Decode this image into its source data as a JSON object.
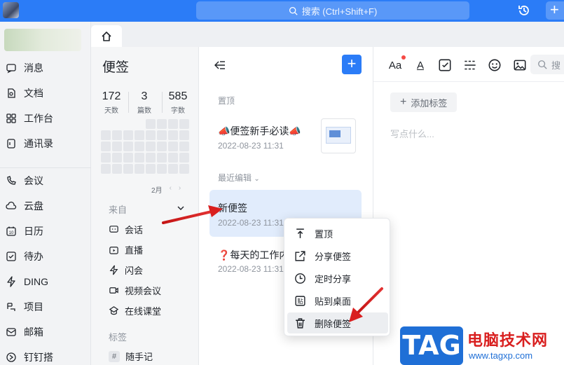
{
  "topbar": {
    "search_placeholder": "搜索 (Ctrl+Shift+F)",
    "brand_color": "#2b7cf7"
  },
  "sidebar": {
    "items": [
      {
        "label": "消息",
        "icon": "message-icon"
      },
      {
        "label": "文档",
        "icon": "document-icon"
      },
      {
        "label": "工作台",
        "icon": "workbench-icon"
      },
      {
        "label": "通讯录",
        "icon": "contacts-icon"
      },
      {
        "label": "会议",
        "icon": "meeting-icon"
      },
      {
        "label": "云盘",
        "icon": "cloud-icon"
      },
      {
        "label": "日历",
        "icon": "calendar-icon"
      },
      {
        "label": "待办",
        "icon": "todo-icon"
      },
      {
        "label": "DING",
        "icon": "ding-icon"
      },
      {
        "label": "项目",
        "icon": "project-icon"
      },
      {
        "label": "邮箱",
        "icon": "mail-icon"
      },
      {
        "label": "钉钉搭",
        "icon": "builder-icon"
      }
    ]
  },
  "category": {
    "title": "便签",
    "stats": [
      {
        "value": "172",
        "label": "天数"
      },
      {
        "value": "3",
        "label": "篇数"
      },
      {
        "value": "585",
        "label": "字数"
      }
    ],
    "month": "2月",
    "source_label": "来自",
    "sources": [
      {
        "label": "会话",
        "icon": "chat-icon"
      },
      {
        "label": "直播",
        "icon": "live-icon"
      },
      {
        "label": "闪会",
        "icon": "flash-meeting-icon"
      },
      {
        "label": "视频会议",
        "icon": "video-meeting-icon"
      },
      {
        "label": "在线课堂",
        "icon": "classroom-icon"
      }
    ],
    "tags_label": "标签",
    "tags": [
      {
        "label": "随手记",
        "symbol": "#"
      }
    ]
  },
  "list": {
    "pinned_label": "置顶",
    "recent_label": "最近编辑",
    "pinned_notes": [
      {
        "title": "📣便签新手必读📣",
        "time": "2022-08-23 11:31"
      }
    ],
    "recent_notes": [
      {
        "title": "新便签",
        "time": "2022-08-23 11:31"
      },
      {
        "title": "❓每天的工作内容",
        "time": "2022-08-23 11:31"
      }
    ]
  },
  "editor": {
    "add_tag": "添加标签",
    "placeholder": "写点什么...",
    "search_label": "搜",
    "font_size_label": "Aa",
    "font_color_label": "A"
  },
  "context_menu": {
    "items": [
      {
        "label": "置顶",
        "icon": "pin-top-icon"
      },
      {
        "label": "分享便签",
        "icon": "share-icon"
      },
      {
        "label": "定时分享",
        "icon": "clock-icon"
      },
      {
        "label": "贴到桌面",
        "icon": "paste-icon"
      },
      {
        "label": "删除便签",
        "icon": "trash-icon"
      }
    ]
  },
  "watermark": {
    "tag": "TAG",
    "title": "电脑技术网",
    "url": "www.tagxp.com"
  }
}
